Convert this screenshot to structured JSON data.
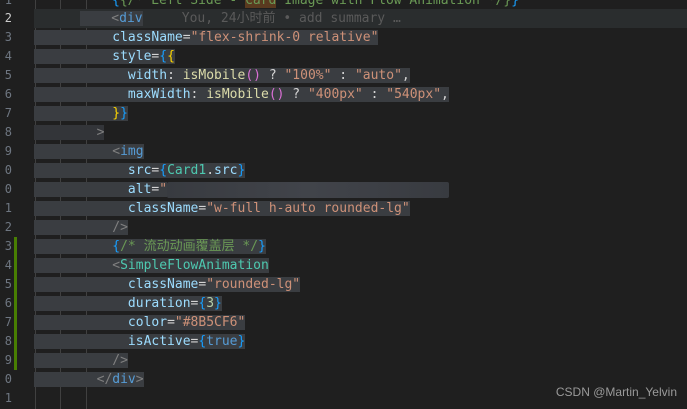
{
  "gutter": {
    "numbers": [
      "1",
      "2",
      "3",
      "4",
      "5",
      "6",
      "7",
      "8",
      "9",
      "0",
      "0",
      "1",
      "2",
      "3",
      "4",
      "5",
      "6",
      "7",
      "8",
      "9",
      "0",
      "1",
      "2"
    ]
  },
  "lines": {
    "l1_a": "{/* Left Side - ",
    "l1_b": "Card",
    "l1_c": " Image with Flow Animation */}",
    "l2_tag": "div",
    "l2_blame": "You, 24小时前 • add summary …",
    "l3_attr": "className",
    "l3_val": "\"flex-shrink-0 relative\"",
    "l4_attr": "style",
    "l5_key": "width",
    "l5_fn": "isMobile",
    "l5_v1": "\"100%\"",
    "l5_v2": "\"auto\"",
    "l6_key": "maxWidth",
    "l6_fn": "isMobile",
    "l6_v1": "\"400px\"",
    "l6_v2": "\"540px\"",
    "l9_tag": "img",
    "l10_attr": "src",
    "l10_obj": "Card1",
    "l10_prop": "src",
    "l11_attr": "alt",
    "l11_val": "\"",
    "l12_attr": "className",
    "l12_val": "\"w-full h-auto rounded-lg\"",
    "l14_comment": "/* 流动动画覆盖层 */",
    "l15_tag": "SimpleFlowAnimation",
    "l16_attr": "className",
    "l16_val": "\"rounded-lg\"",
    "l17_attr": "duration",
    "l17_val": "3",
    "l18_attr": "color",
    "l18_val": "\"#8B5CF6\"",
    "l19_attr": "isActive",
    "l19_val": "true",
    "l21_tag": "div"
  },
  "watermark": "CSDN @Martin_Yelvin",
  "colors": {
    "background": "#1f1f1f",
    "selection": "#3a3d41",
    "git_added": "#487e02"
  }
}
